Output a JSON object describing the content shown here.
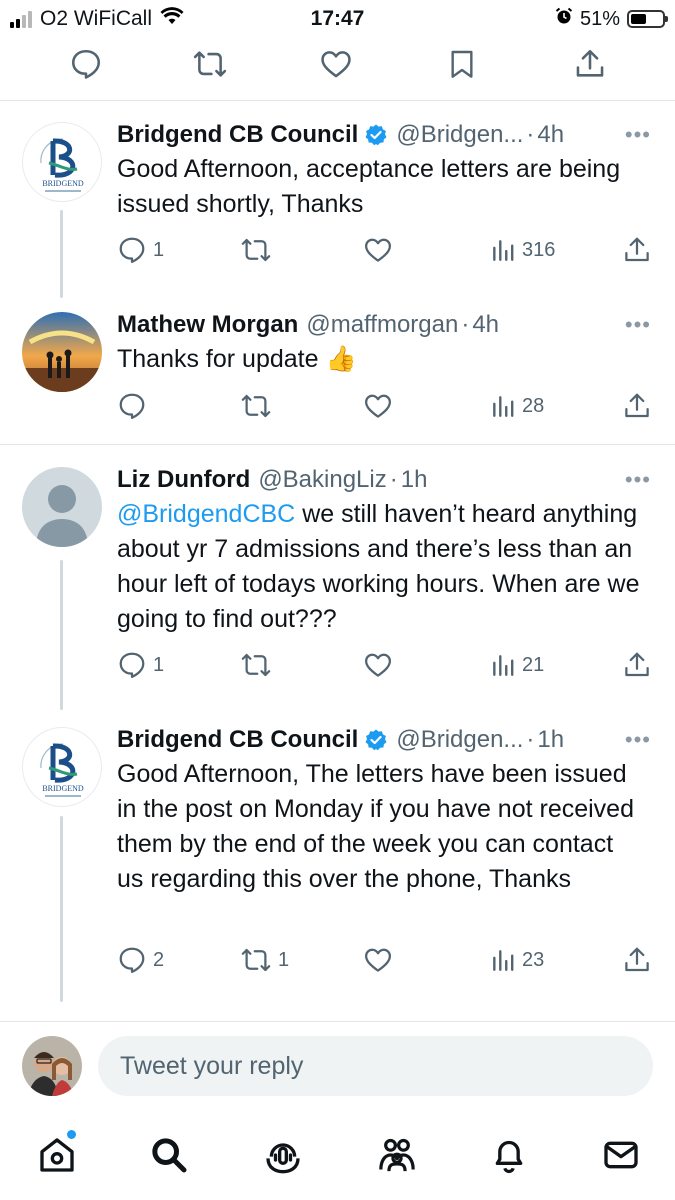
{
  "status_bar": {
    "carrier": "O2 WiFiCall",
    "time": "17:47",
    "battery_percent": "51%",
    "battery_level": 0.51,
    "icons": [
      "signal-icon",
      "wifi-icon",
      "alarm-icon",
      "battery-icon"
    ]
  },
  "top_actions": [
    "reply-icon",
    "retweet-icon",
    "like-icon",
    "bookmark-icon",
    "share-icon"
  ],
  "tweets": [
    {
      "name": "Bridgend CB Council",
      "verified": true,
      "handle": "@Bridgen...",
      "dot": "·",
      "time": "4h",
      "more": "•••",
      "text": "Good Afternoon, acceptance letters are being issued shortly, Thanks",
      "replies": "1",
      "retweets": "",
      "views": "316",
      "avatar_logo_text": "BRIDGEND"
    },
    {
      "name": "Mathew Morgan",
      "verified": false,
      "handle": "@maffmorgan",
      "dot": "·",
      "time": "4h",
      "more": "•••",
      "text": "Thanks for update",
      "emoji": "👍",
      "replies": "",
      "retweets": "",
      "views": "28"
    },
    {
      "name": "Liz Dunford",
      "verified": false,
      "handle": "@BakingLiz",
      "dot": "·",
      "time": "1h",
      "more": "•••",
      "mention": "@BridgendCBC",
      "text": " we still haven’t heard anything about yr 7 admissions and there’s less than an hour left of todays working hours. When are we going to find out???",
      "replies": "1",
      "retweets": "",
      "views": "21"
    },
    {
      "name": "Bridgend CB Council",
      "verified": true,
      "handle": "@Bridgen...",
      "dot": "·",
      "time": "1h",
      "more": "•••",
      "text": "Good Afternoon, The letters have been issued in the post on Monday if you have not received them by the end of the week you can contact us regarding this over the phone, Thanks",
      "replies": "2",
      "retweets": "1",
      "views": "23",
      "avatar_logo_text": "BRIDGEND"
    }
  ],
  "reply_bar": {
    "placeholder": "Tweet your reply"
  },
  "tab_bar": [
    "home-icon",
    "search-icon",
    "spaces-icon",
    "communities-icon",
    "notifications-icon",
    "messages-icon"
  ],
  "colors": {
    "accent": "#1d9bf0",
    "text": "#0f1419",
    "secondary_text": "#536471",
    "divider": "#e1e6ea",
    "input_bg": "#eff3f4"
  }
}
